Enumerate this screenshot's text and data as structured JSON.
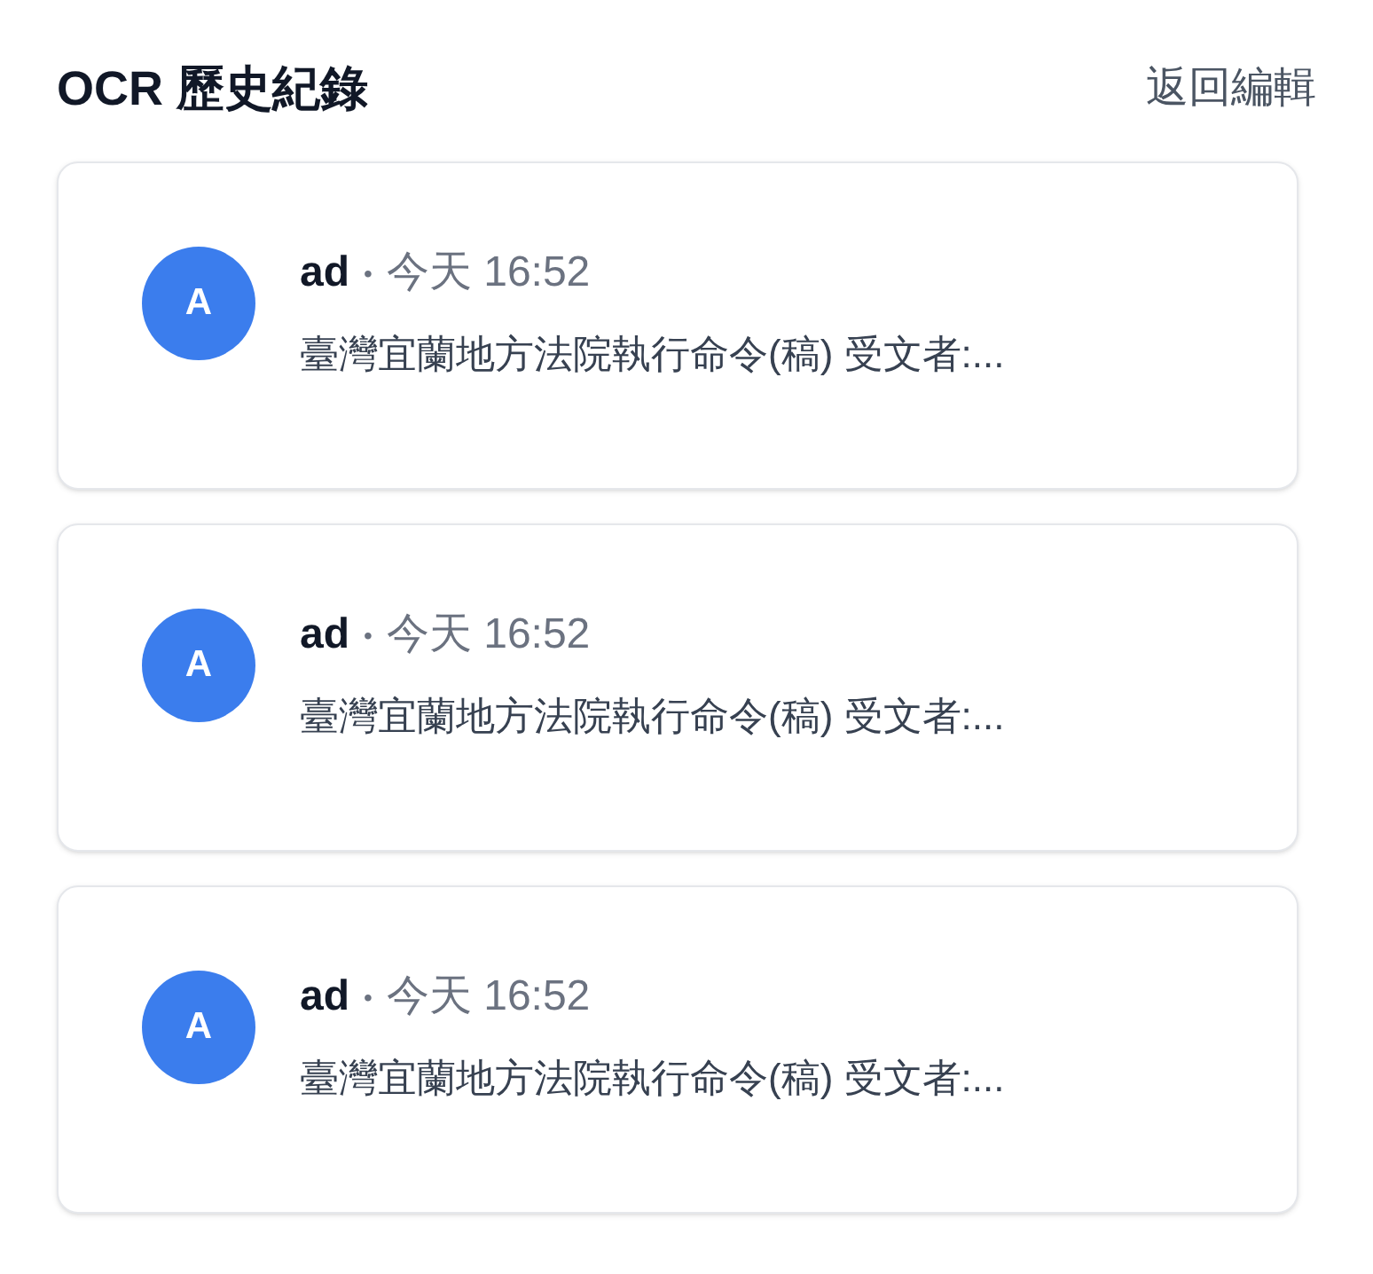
{
  "header": {
    "title": "OCR 歷史紀錄",
    "back_link": "返回編輯"
  },
  "records": [
    {
      "avatar": "A",
      "user": "ad",
      "separator": "•",
      "time": "今天 16:52",
      "preview": "臺灣宜蘭地方法院執行命令(稿) 受文者:..."
    },
    {
      "avatar": "A",
      "user": "ad",
      "separator": "•",
      "time": "今天 16:52",
      "preview": "臺灣宜蘭地方法院執行命令(稿) 受文者:..."
    },
    {
      "avatar": "A",
      "user": "ad",
      "separator": "•",
      "time": "今天 16:52",
      "preview": "臺灣宜蘭地方法院執行命令(稿) 受文者:..."
    }
  ]
}
